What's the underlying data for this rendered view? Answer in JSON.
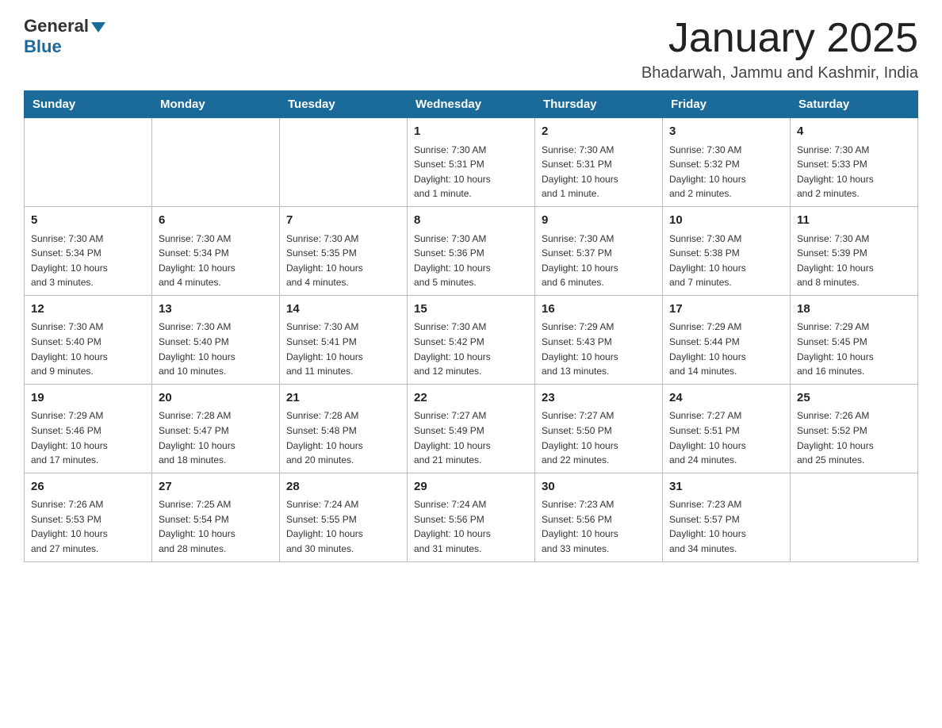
{
  "logo": {
    "general": "General",
    "blue": "Blue"
  },
  "title": "January 2025",
  "subtitle": "Bhadarwah, Jammu and Kashmir, India",
  "days": [
    "Sunday",
    "Monday",
    "Tuesday",
    "Wednesday",
    "Thursday",
    "Friday",
    "Saturday"
  ],
  "weeks": [
    [
      {
        "day": "",
        "info": ""
      },
      {
        "day": "",
        "info": ""
      },
      {
        "day": "",
        "info": ""
      },
      {
        "day": "1",
        "info": "Sunrise: 7:30 AM\nSunset: 5:31 PM\nDaylight: 10 hours\nand 1 minute."
      },
      {
        "day": "2",
        "info": "Sunrise: 7:30 AM\nSunset: 5:31 PM\nDaylight: 10 hours\nand 1 minute."
      },
      {
        "day": "3",
        "info": "Sunrise: 7:30 AM\nSunset: 5:32 PM\nDaylight: 10 hours\nand 2 minutes."
      },
      {
        "day": "4",
        "info": "Sunrise: 7:30 AM\nSunset: 5:33 PM\nDaylight: 10 hours\nand 2 minutes."
      }
    ],
    [
      {
        "day": "5",
        "info": "Sunrise: 7:30 AM\nSunset: 5:34 PM\nDaylight: 10 hours\nand 3 minutes."
      },
      {
        "day": "6",
        "info": "Sunrise: 7:30 AM\nSunset: 5:34 PM\nDaylight: 10 hours\nand 4 minutes."
      },
      {
        "day": "7",
        "info": "Sunrise: 7:30 AM\nSunset: 5:35 PM\nDaylight: 10 hours\nand 4 minutes."
      },
      {
        "day": "8",
        "info": "Sunrise: 7:30 AM\nSunset: 5:36 PM\nDaylight: 10 hours\nand 5 minutes."
      },
      {
        "day": "9",
        "info": "Sunrise: 7:30 AM\nSunset: 5:37 PM\nDaylight: 10 hours\nand 6 minutes."
      },
      {
        "day": "10",
        "info": "Sunrise: 7:30 AM\nSunset: 5:38 PM\nDaylight: 10 hours\nand 7 minutes."
      },
      {
        "day": "11",
        "info": "Sunrise: 7:30 AM\nSunset: 5:39 PM\nDaylight: 10 hours\nand 8 minutes."
      }
    ],
    [
      {
        "day": "12",
        "info": "Sunrise: 7:30 AM\nSunset: 5:40 PM\nDaylight: 10 hours\nand 9 minutes."
      },
      {
        "day": "13",
        "info": "Sunrise: 7:30 AM\nSunset: 5:40 PM\nDaylight: 10 hours\nand 10 minutes."
      },
      {
        "day": "14",
        "info": "Sunrise: 7:30 AM\nSunset: 5:41 PM\nDaylight: 10 hours\nand 11 minutes."
      },
      {
        "day": "15",
        "info": "Sunrise: 7:30 AM\nSunset: 5:42 PM\nDaylight: 10 hours\nand 12 minutes."
      },
      {
        "day": "16",
        "info": "Sunrise: 7:29 AM\nSunset: 5:43 PM\nDaylight: 10 hours\nand 13 minutes."
      },
      {
        "day": "17",
        "info": "Sunrise: 7:29 AM\nSunset: 5:44 PM\nDaylight: 10 hours\nand 14 minutes."
      },
      {
        "day": "18",
        "info": "Sunrise: 7:29 AM\nSunset: 5:45 PM\nDaylight: 10 hours\nand 16 minutes."
      }
    ],
    [
      {
        "day": "19",
        "info": "Sunrise: 7:29 AM\nSunset: 5:46 PM\nDaylight: 10 hours\nand 17 minutes."
      },
      {
        "day": "20",
        "info": "Sunrise: 7:28 AM\nSunset: 5:47 PM\nDaylight: 10 hours\nand 18 minutes."
      },
      {
        "day": "21",
        "info": "Sunrise: 7:28 AM\nSunset: 5:48 PM\nDaylight: 10 hours\nand 20 minutes."
      },
      {
        "day": "22",
        "info": "Sunrise: 7:27 AM\nSunset: 5:49 PM\nDaylight: 10 hours\nand 21 minutes."
      },
      {
        "day": "23",
        "info": "Sunrise: 7:27 AM\nSunset: 5:50 PM\nDaylight: 10 hours\nand 22 minutes."
      },
      {
        "day": "24",
        "info": "Sunrise: 7:27 AM\nSunset: 5:51 PM\nDaylight: 10 hours\nand 24 minutes."
      },
      {
        "day": "25",
        "info": "Sunrise: 7:26 AM\nSunset: 5:52 PM\nDaylight: 10 hours\nand 25 minutes."
      }
    ],
    [
      {
        "day": "26",
        "info": "Sunrise: 7:26 AM\nSunset: 5:53 PM\nDaylight: 10 hours\nand 27 minutes."
      },
      {
        "day": "27",
        "info": "Sunrise: 7:25 AM\nSunset: 5:54 PM\nDaylight: 10 hours\nand 28 minutes."
      },
      {
        "day": "28",
        "info": "Sunrise: 7:24 AM\nSunset: 5:55 PM\nDaylight: 10 hours\nand 30 minutes."
      },
      {
        "day": "29",
        "info": "Sunrise: 7:24 AM\nSunset: 5:56 PM\nDaylight: 10 hours\nand 31 minutes."
      },
      {
        "day": "30",
        "info": "Sunrise: 7:23 AM\nSunset: 5:56 PM\nDaylight: 10 hours\nand 33 minutes."
      },
      {
        "day": "31",
        "info": "Sunrise: 7:23 AM\nSunset: 5:57 PM\nDaylight: 10 hours\nand 34 minutes."
      },
      {
        "day": "",
        "info": ""
      }
    ]
  ]
}
